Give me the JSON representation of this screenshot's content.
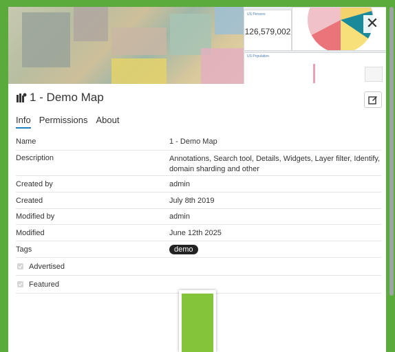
{
  "thumbnail": {
    "counter_widget": {
      "title": "US Persons",
      "value": "126,579,002"
    },
    "bar_widget": {
      "title": "US Population"
    },
    "close_symbol": "✕"
  },
  "resource": {
    "title": "1 - Demo Map",
    "icon": "map-icon"
  },
  "tabs": [
    {
      "label": "Info",
      "active": true
    },
    {
      "label": "Permissions",
      "active": false
    },
    {
      "label": "About",
      "active": false
    }
  ],
  "info": {
    "name_label": "Name",
    "name_value": "1 - Demo Map",
    "description_label": "Description",
    "description_value": "Annotations, Search tool, Details, Widgets, Layer filter, Identify, domain sharding and other",
    "created_by_label": "Created by",
    "created_by_value": "admin",
    "created_label": "Created",
    "created_value": "July 8th 2019",
    "modified_by_label": "Modified by",
    "modified_by_value": "admin",
    "modified_label": "Modified",
    "modified_value": "June 12th 2025",
    "tags_label": "Tags",
    "tag": "demo",
    "advertised_label": "Advertised",
    "featured_label": "Featured"
  },
  "colors": {
    "accent": "#1f7fbf",
    "background": "#5aaa3c",
    "loader": "#84c43a"
  }
}
